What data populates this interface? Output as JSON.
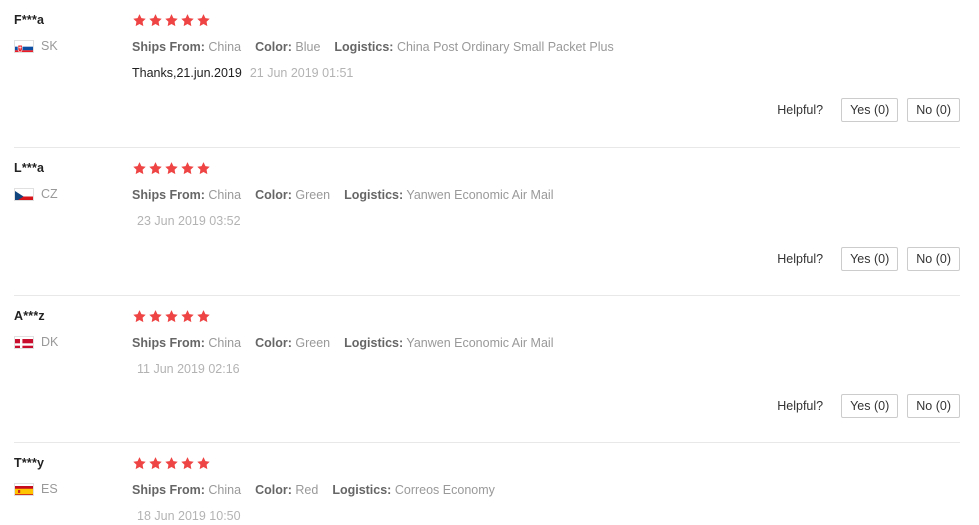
{
  "labels": {
    "ships_from": "Ships From:",
    "color": "Color:",
    "logistics": "Logistics:",
    "helpful": "Helpful?",
    "yes": "Yes (0)",
    "no": "No (0)"
  },
  "colors": {
    "star": "#ef4444",
    "label": "#666666",
    "value": "#999999",
    "date": "#b3b3b3",
    "separator": "#e8e8e8",
    "button_border": "#cccccc"
  },
  "reviews": [
    {
      "username": "F***a",
      "country_code": "SK",
      "flag_name": "flag-slovakia",
      "rating": 5,
      "ships_from": "China",
      "color": "Blue",
      "logistics": "China Post Ordinary Small Packet Plus",
      "body": "Thanks,21.jun.2019",
      "date": "21 Jun 2019 01:51",
      "has_separator": false,
      "helpful_yes": "Yes (0)",
      "helpful_no": "No (0)"
    },
    {
      "username": "L***a",
      "country_code": "CZ",
      "flag_name": "flag-czechia",
      "rating": 5,
      "ships_from": "China",
      "color": "Green",
      "logistics": "Yanwen Economic Air Mail",
      "body": "",
      "date": "23 Jun 2019 03:52",
      "has_separator": true,
      "helpful_yes": "Yes (0)",
      "helpful_no": "No (0)"
    },
    {
      "username": "A***z",
      "country_code": "DK",
      "flag_name": "flag-denmark",
      "rating": 5,
      "ships_from": "China",
      "color": "Green",
      "logistics": "Yanwen Economic Air Mail",
      "body": "",
      "date": "11 Jun 2019 02:16",
      "has_separator": true,
      "helpful_yes": "Yes (0)",
      "helpful_no": "No (0)"
    },
    {
      "username": "T***y",
      "country_code": "ES",
      "flag_name": "flag-spain",
      "rating": 5,
      "ships_from": "China",
      "color": "Red",
      "logistics": "Correos Economy",
      "body": "",
      "date": "18 Jun 2019 10:50",
      "has_separator": true,
      "helpful_yes": "",
      "helpful_no": ""
    }
  ]
}
